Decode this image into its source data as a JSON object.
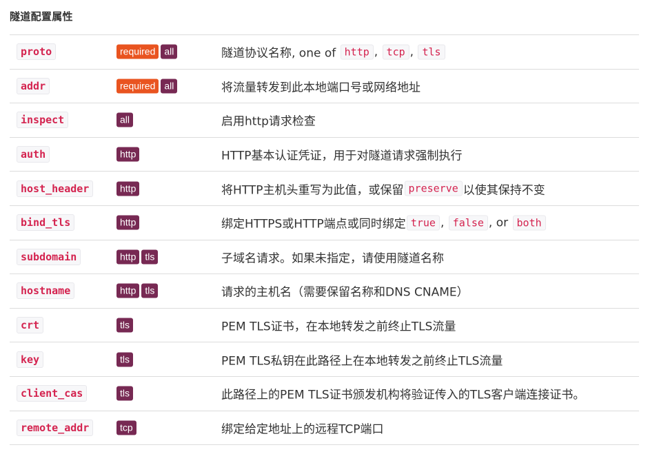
{
  "heading": "隧道配置属性",
  "rows": [
    {
      "name": "proto",
      "badges": [
        {
          "label": "required",
          "kind": "required"
        },
        {
          "label": "all",
          "kind": "scope"
        }
      ],
      "desc": [
        {
          "t": "text",
          "v": "隧道协议名称, one of "
        },
        {
          "t": "code",
          "v": "http"
        },
        {
          "t": "text",
          "v": ", "
        },
        {
          "t": "code",
          "v": "tcp"
        },
        {
          "t": "text",
          "v": ", "
        },
        {
          "t": "code",
          "v": "tls"
        }
      ]
    },
    {
      "name": "addr",
      "badges": [
        {
          "label": "required",
          "kind": "required"
        },
        {
          "label": "all",
          "kind": "scope"
        }
      ],
      "desc": [
        {
          "t": "text",
          "v": "将流量转发到此本地端口号或网络地址"
        }
      ]
    },
    {
      "name": "inspect",
      "badges": [
        {
          "label": "all",
          "kind": "scope"
        }
      ],
      "desc": [
        {
          "t": "text",
          "v": "启用http请求检查"
        }
      ]
    },
    {
      "name": "auth",
      "badges": [
        {
          "label": "http",
          "kind": "scope"
        }
      ],
      "desc": [
        {
          "t": "text",
          "v": "HTTP基本认证凭证，用于对隧道请求强制执行"
        }
      ]
    },
    {
      "name": "host_header",
      "badges": [
        {
          "label": "http",
          "kind": "scope"
        }
      ],
      "desc": [
        {
          "t": "text",
          "v": "将HTTP主机头重写为此值，或保留"
        },
        {
          "t": "code",
          "v": "preserve"
        },
        {
          "t": "text",
          "v": "以使其保持不变"
        }
      ]
    },
    {
      "name": "bind_tls",
      "badges": [
        {
          "label": "http",
          "kind": "scope"
        }
      ],
      "desc": [
        {
          "t": "text",
          "v": "绑定HTTPS或HTTP端点或同时绑定"
        },
        {
          "t": "code",
          "v": "true"
        },
        {
          "t": "text",
          "v": ", "
        },
        {
          "t": "code",
          "v": "false"
        },
        {
          "t": "text",
          "v": ", or "
        },
        {
          "t": "code",
          "v": "both"
        }
      ]
    },
    {
      "name": "subdomain",
      "badges": [
        {
          "label": "http",
          "kind": "scope"
        },
        {
          "label": "tls",
          "kind": "scope"
        }
      ],
      "desc": [
        {
          "t": "text",
          "v": "子域名请求。如果未指定，请使用隧道名称"
        }
      ]
    },
    {
      "name": "hostname",
      "badges": [
        {
          "label": "http",
          "kind": "scope"
        },
        {
          "label": "tls",
          "kind": "scope"
        }
      ],
      "desc": [
        {
          "t": "text",
          "v": "请求的主机名（需要保留名称和DNS CNAME）"
        }
      ]
    },
    {
      "name": "crt",
      "badges": [
        {
          "label": "tls",
          "kind": "scope"
        }
      ],
      "desc": [
        {
          "t": "text",
          "v": "PEM TLS证书，在本地转发之前终止TLS流量"
        }
      ]
    },
    {
      "name": "key",
      "badges": [
        {
          "label": "tls",
          "kind": "scope"
        }
      ],
      "desc": [
        {
          "t": "text",
          "v": "PEM TLS私钥在此路径上在本地转发之前终止TLS流量"
        }
      ]
    },
    {
      "name": "client_cas",
      "badges": [
        {
          "label": "tls",
          "kind": "scope"
        }
      ],
      "desc": [
        {
          "t": "text",
          "v": "此路径上的PEM TLS证书颁发机构将验证传入的TLS客户端连接证书。"
        }
      ]
    },
    {
      "name": "remote_addr",
      "badges": [
        {
          "label": "tcp",
          "kind": "scope"
        }
      ],
      "desc": [
        {
          "t": "text",
          "v": "绑定给定地址上的远程TCP端口"
        }
      ]
    }
  ],
  "colors": {
    "required_badge": "#e95420",
    "scope_badge": "#772953",
    "code_text": "#d4234f"
  }
}
